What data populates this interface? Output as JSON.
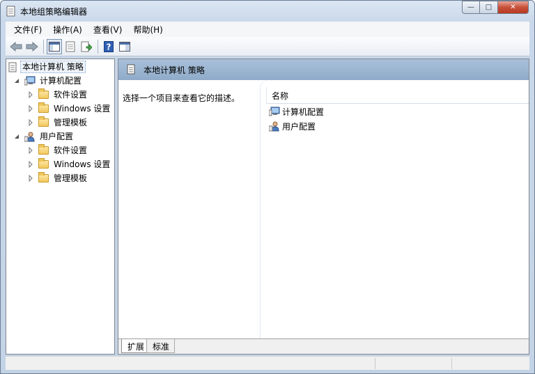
{
  "window": {
    "title": "本地组策略编辑器",
    "controls": {
      "minimize": "—",
      "maximize": "□",
      "close": "✕"
    }
  },
  "menubar": {
    "items": [
      "文件(F)",
      "操作(A)",
      "查看(V)",
      "帮助(H)"
    ]
  },
  "toolbar": {
    "icons": [
      "back-arrow-icon",
      "forward-arrow-icon",
      "show-hide-tree-icon",
      "properties-icon",
      "export-list-icon",
      "help-icon",
      "extended-view-icon"
    ]
  },
  "tree": {
    "root": "本地计算机 策略",
    "computer": {
      "label": "计算机配置",
      "children": [
        "软件设置",
        "Windows 设置",
        "管理模板"
      ]
    },
    "user": {
      "label": "用户配置",
      "children": [
        "软件设置",
        "Windows 设置",
        "管理模板"
      ]
    }
  },
  "right": {
    "header_title": "本地计算机 策略",
    "description": "选择一个项目来查看它的描述。",
    "column_name": "名称",
    "items": [
      "计算机配置",
      "用户配置"
    ]
  },
  "tabs": [
    "扩展",
    "标准"
  ],
  "colors": {
    "header_blue": "#9bb5d1",
    "close_red": "#c7503a",
    "folder_yellow": "#f3c85e"
  }
}
